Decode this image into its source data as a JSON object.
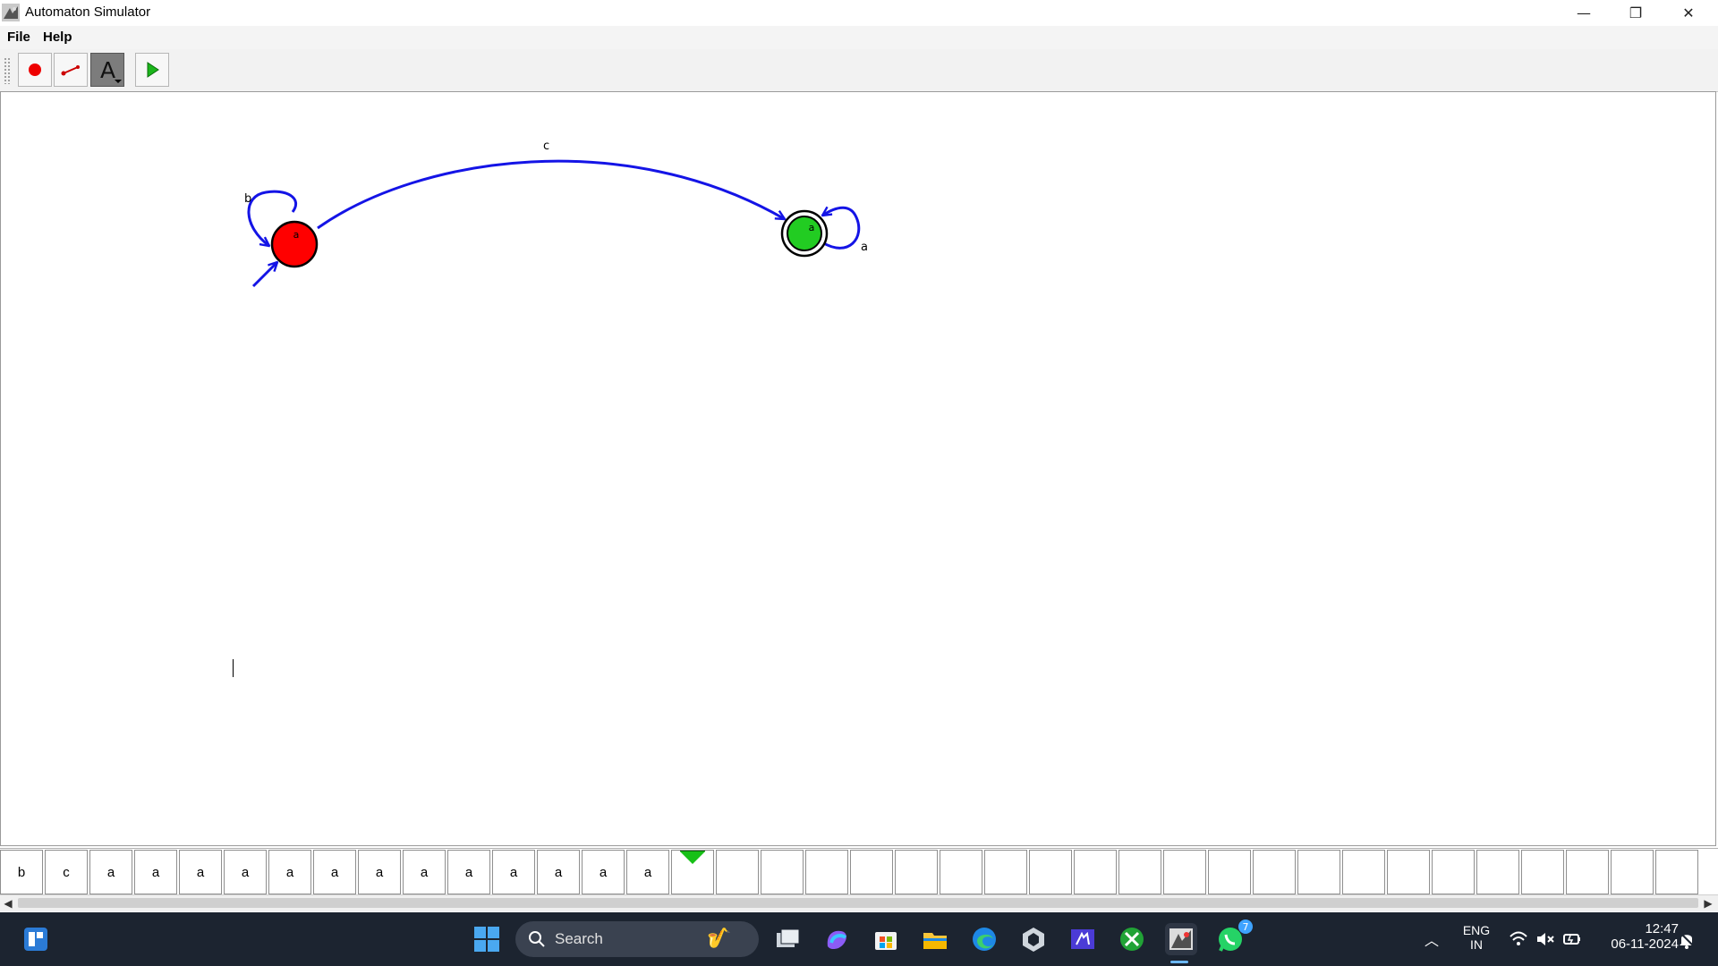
{
  "window": {
    "title": "Automaton Simulator",
    "minimize_glyph": "—",
    "restore_glyph": "❐",
    "close_glyph": "✕"
  },
  "menu": {
    "items": [
      {
        "label": "File"
      },
      {
        "label": "Help"
      }
    ]
  },
  "toolbar": {
    "tools": [
      {
        "name": "state-tool",
        "icon": "red-circle-icon",
        "active": false
      },
      {
        "name": "transition-tool",
        "icon": "line-tool-icon",
        "active": false
      },
      {
        "name": "text-tool",
        "icon": "letter-a-icon",
        "label": "A",
        "active": true
      },
      {
        "name": "run-tool",
        "icon": "play-icon",
        "active": false
      }
    ]
  },
  "automaton": {
    "states": [
      {
        "id": "start",
        "label": "a",
        "color": "#ff0000",
        "initial": true,
        "accepting": false
      },
      {
        "id": "final",
        "label": "a",
        "color": "#00cc00",
        "initial": false,
        "accepting": true
      }
    ],
    "transitions": [
      {
        "from": "start",
        "to": "start",
        "symbol": "b"
      },
      {
        "from": "start",
        "to": "final",
        "symbol": "c"
      },
      {
        "from": "final",
        "to": "final",
        "symbol": "a"
      }
    ],
    "edge_color": "#1414e6"
  },
  "tape": {
    "cells": [
      "b",
      "c",
      "a",
      "a",
      "a",
      "a",
      "a",
      "a",
      "a",
      "a",
      "a",
      "a",
      "a",
      "a",
      "a",
      "",
      "",
      "",
      "",
      "",
      "",
      "",
      "",
      "",
      "",
      "",
      "",
      "",
      "",
      "",
      "",
      "",
      "",
      "",
      "",
      "",
      "",
      ""
    ],
    "head_index": 15,
    "head_color": "#17c017"
  },
  "taskbar": {
    "search_placeholder": "Search",
    "whatsapp_badge": "7",
    "lang_top": "ENG",
    "lang_bottom": "IN",
    "time": "12:47",
    "date": "06-11-2024"
  }
}
